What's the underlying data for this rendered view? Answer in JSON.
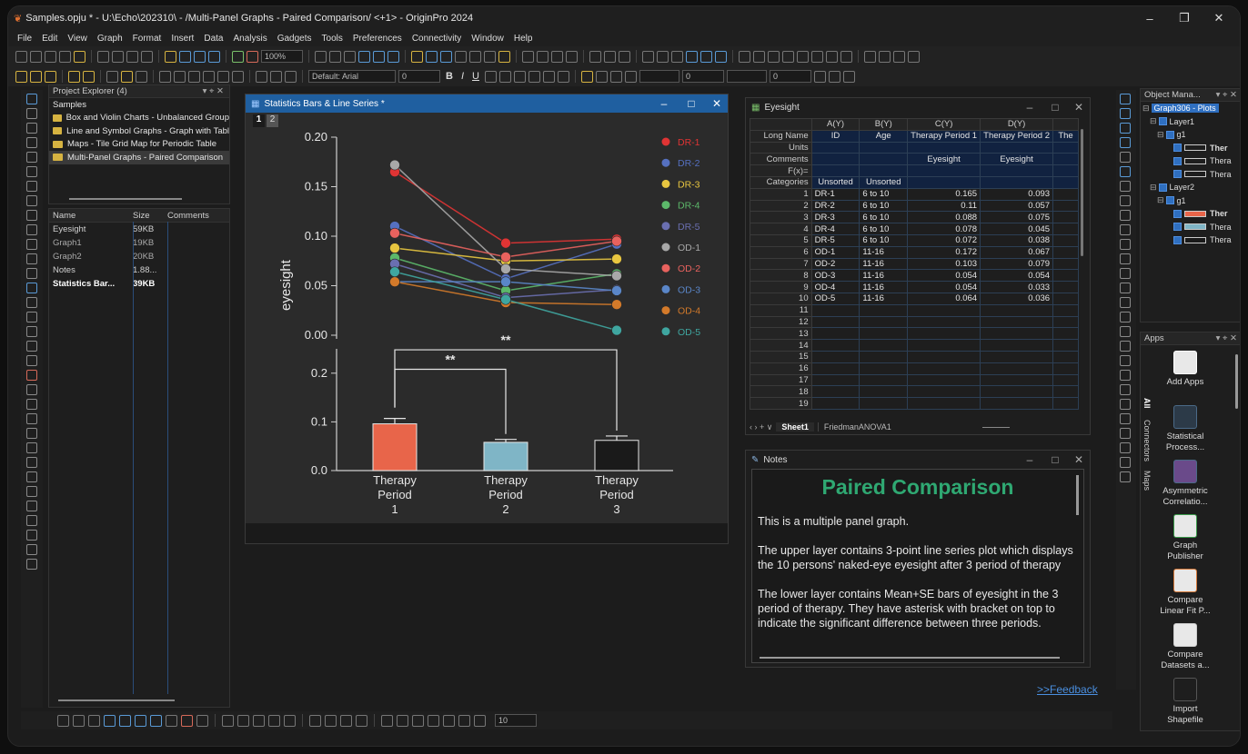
{
  "window": {
    "title": "Samples.opju * - U:\\Echo\\202310\\ - /Multi-Panel Graphs - Paired Comparison/ <+1> - OriginPro 2024",
    "minimize": "–",
    "maximize": "❐",
    "close": "✕"
  },
  "menu": [
    "File",
    "Edit",
    "View",
    "Graph",
    "Format",
    "Insert",
    "Data",
    "Analysis",
    "Gadgets",
    "Tools",
    "Preferences",
    "Connectivity",
    "Window",
    "Help"
  ],
  "toolbar": {
    "zoom": "100%",
    "font_combo": "Default: Arial",
    "font_size": "0",
    "bold": "B",
    "italic": "I",
    "underline": "U",
    "bottom_size": "10"
  },
  "project_explorer": {
    "title": "Project Explorer (4)",
    "root": "Samples",
    "folders": [
      "Box and Violin Charts - Unbalanced Group",
      "Line and Symbol Graphs - Graph with Tabl",
      "Maps - Tile Grid Map for Periodic Table",
      "Multi-Panel Graphs - Paired Comparison"
    ],
    "columns": {
      "name": "Name",
      "size": "Size",
      "comments": "Comments"
    },
    "files": [
      {
        "name": "Eyesight",
        "size": "59KB"
      },
      {
        "name": "Graph1",
        "size": "19KB"
      },
      {
        "name": "Graph2",
        "size": "20KB"
      },
      {
        "name": "Notes",
        "size": "1.88..."
      },
      {
        "name": "Statistics Bar...",
        "size": "39KB"
      }
    ]
  },
  "graph_window": {
    "title": "Statistics Bars & Line Series *",
    "layer_tabs": [
      "1",
      "2"
    ]
  },
  "chart_data": [
    {
      "type": "line",
      "ylabel": "eyesight",
      "ylim": [
        0,
        0.2
      ],
      "yticks": [
        "0.00",
        "0.05",
        "0.10",
        "0.15",
        "0.20"
      ],
      "x": [
        "Therapy Period 1",
        "Therapy Period 2",
        "Therapy Period 3"
      ],
      "legend_position": "right",
      "series": [
        {
          "name": "DR-1",
          "color": "#e03434",
          "values": [
            0.165,
            0.093,
            0.097
          ]
        },
        {
          "name": "DR-2",
          "color": "#5570c0",
          "values": [
            0.11,
            0.057,
            0.092
          ]
        },
        {
          "name": "DR-3",
          "color": "#e8c640",
          "values": [
            0.088,
            0.075,
            0.077
          ]
        },
        {
          "name": "DR-4",
          "color": "#5cb86a",
          "values": [
            0.078,
            0.045,
            0.062
          ]
        },
        {
          "name": "DR-5",
          "color": "#6a6fb0",
          "values": [
            0.072,
            0.038,
            0.046
          ]
        },
        {
          "name": "OD-1",
          "color": "#a8a8a8",
          "values": [
            0.172,
            0.067,
            0.06
          ]
        },
        {
          "name": "OD-2",
          "color": "#e8625e",
          "values": [
            0.103,
            0.079,
            0.095
          ]
        },
        {
          "name": "OD-3",
          "color": "#5a86c8",
          "values": [
            0.054,
            0.054,
            0.045
          ]
        },
        {
          "name": "OD-4",
          "color": "#d37a2a",
          "values": [
            0.054,
            0.033,
            0.031
          ]
        },
        {
          "name": "OD-5",
          "color": "#3fa6a0",
          "values": [
            0.064,
            0.036,
            0.005
          ]
        }
      ]
    },
    {
      "type": "bar",
      "categories": [
        "Therapy\nPeriod\n1",
        "Therapy\nPeriod\n2",
        "Therapy\nPeriod\n3"
      ],
      "values": [
        0.096,
        0.058,
        0.062
      ],
      "errors": [
        0.011,
        0.006,
        0.009
      ],
      "colors": [
        "#e8654a",
        "#7fb5c6",
        "#1a1a1a"
      ],
      "ylim": [
        0,
        0.25
      ],
      "yticks": [
        "0.0",
        "0.1",
        "0.2"
      ],
      "annotations": [
        {
          "text": "**",
          "from": 0,
          "to": 1
        },
        {
          "text": "**",
          "from": 0,
          "to": 2
        }
      ]
    }
  ],
  "worksheet": {
    "title": "Eyesight",
    "col_headers": [
      "A(Y)",
      "B(Y)",
      "C(Y)",
      "D(Y)",
      ""
    ],
    "meta_rows": [
      {
        "label": "Long Name",
        "cells": [
          "ID",
          "Age",
          "Therapy Period 1",
          "Therapy Period 2",
          "The"
        ]
      },
      {
        "label": "Units",
        "cells": [
          "",
          "",
          "",
          "",
          ""
        ]
      },
      {
        "label": "Comments",
        "cells": [
          "",
          "",
          "Eyesight",
          "Eyesight",
          ""
        ]
      },
      {
        "label": "F(x)=",
        "cells": [
          "",
          "",
          "",
          "",
          ""
        ]
      },
      {
        "label": "Categories",
        "cells": [
          "Unsorted",
          "Unsorted",
          "",
          "",
          ""
        ]
      }
    ],
    "rows": [
      [
        "1",
        "DR-1",
        "6 to 10",
        "0.165",
        "0.093"
      ],
      [
        "2",
        "DR-2",
        "6 to 10",
        "0.11",
        "0.057"
      ],
      [
        "3",
        "DR-3",
        "6 to 10",
        "0.088",
        "0.075"
      ],
      [
        "4",
        "DR-4",
        "6 to 10",
        "0.078",
        "0.045"
      ],
      [
        "5",
        "DR-5",
        "6 to 10",
        "0.072",
        "0.038"
      ],
      [
        "6",
        "OD-1",
        "11-16",
        "0.172",
        "0.067"
      ],
      [
        "7",
        "OD-2",
        "11-16",
        "0.103",
        "0.079"
      ],
      [
        "8",
        "OD-3",
        "11-16",
        "0.054",
        "0.054"
      ],
      [
        "9",
        "OD-4",
        "11-16",
        "0.054",
        "0.033"
      ],
      [
        "10",
        "OD-5",
        "11-16",
        "0.064",
        "0.036"
      ],
      [
        "11",
        "",
        "",
        "",
        ""
      ],
      [
        "12",
        "",
        "",
        "",
        ""
      ],
      [
        "13",
        "",
        "",
        "",
        ""
      ],
      [
        "14",
        "",
        "",
        "",
        ""
      ],
      [
        "15",
        "",
        "",
        "",
        ""
      ],
      [
        "16",
        "",
        "",
        "",
        ""
      ],
      [
        "17",
        "",
        "",
        "",
        ""
      ],
      [
        "18",
        "",
        "",
        "",
        ""
      ],
      [
        "19",
        "",
        "",
        "",
        ""
      ]
    ],
    "sheet_tabs": [
      "Sheet1",
      "FriedmanANOVA1"
    ]
  },
  "notes": {
    "title": "Notes",
    "heading": "Paired Comparison",
    "paragraphs": [
      "This is a multiple panel graph.",
      "The upper layer contains  3-point line series plot which displays the 10 persons' naked-eye eyesight after 3 period of therapy",
      "The lower layer contains Mean+SE bars of eyesight in the 3 period of therapy. They have asterisk with bracket on top to indicate the significant difference between three periods."
    ],
    "feedback": ">>Feedback"
  },
  "object_manager": {
    "title": "Object Mana...",
    "graph": "Graph306 - Plots",
    "layer1": "Layer1",
    "layer2": "Layer2",
    "group": "g1",
    "plots_layer1": [
      "Ther",
      "Thera",
      "Thera"
    ],
    "plots_layer2": [
      "Ther",
      "Thera",
      "Thera"
    ]
  },
  "apps": {
    "title": "Apps",
    "side_tabs": [
      "All",
      "Connectors",
      "Maps"
    ],
    "items": [
      "Add Apps",
      "Statistical Process...",
      "Asymmetric Correlatio...",
      "Graph Publisher",
      "Compare Linear Fit P...",
      "Compare Datasets a...",
      "Import Shapefile"
    ]
  }
}
